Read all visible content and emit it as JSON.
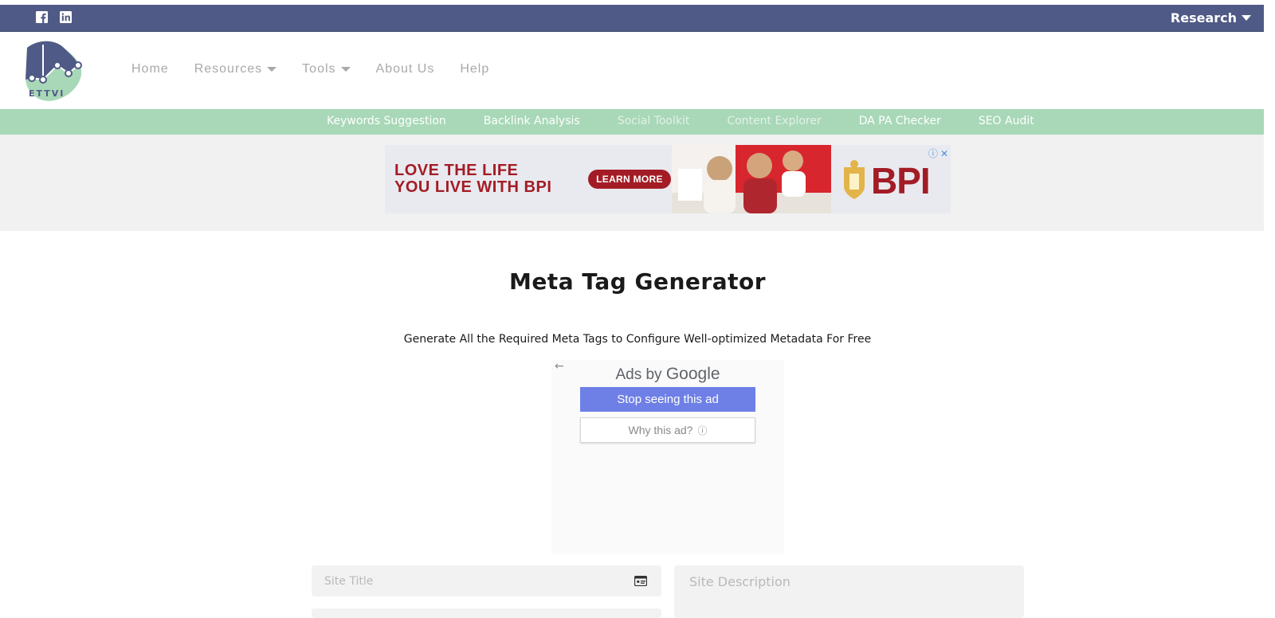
{
  "topbar": {
    "research_label": "Research",
    "icons": [
      "facebook-icon",
      "linkedin-icon"
    ],
    "background": "#505a86"
  },
  "logo": {
    "text": "ETTVI"
  },
  "nav": {
    "items": [
      {
        "label": "Home",
        "dropdown": false
      },
      {
        "label": "Resources",
        "dropdown": true
      },
      {
        "label": "Tools",
        "dropdown": true
      },
      {
        "label": "About Us",
        "dropdown": false
      },
      {
        "label": "Help",
        "dropdown": false
      }
    ]
  },
  "subnav": {
    "background": "#a8d8b7",
    "items": [
      {
        "label": "Keywords Suggestion"
      },
      {
        "label": "Backlink Analysis"
      },
      {
        "label": "Social Toolkit"
      },
      {
        "label": "Content Explorer"
      },
      {
        "label": "DA PA Checker"
      },
      {
        "label": "SEO Audit"
      }
    ]
  },
  "banner_ad": {
    "headline_line1": "LOVE THE LIFE",
    "headline_line2": "YOU LIVE WITH BPI",
    "cta": "LEARN MORE",
    "brand": "BPI",
    "brand_color": "#a31c25"
  },
  "page": {
    "title": "Meta Tag Generator",
    "subtitle": "Generate All the Required Meta Tags to Configure Well-optimized Metadata For Free"
  },
  "google_ad": {
    "ads_by": "Ads by",
    "google": "Google",
    "stop_label": "Stop seeing this ad",
    "why_label": "Why this ad?",
    "button_color": "#6e7fe6"
  },
  "form": {
    "site_title_placeholder": "Site Title",
    "site_description_placeholder": "Site Description"
  }
}
